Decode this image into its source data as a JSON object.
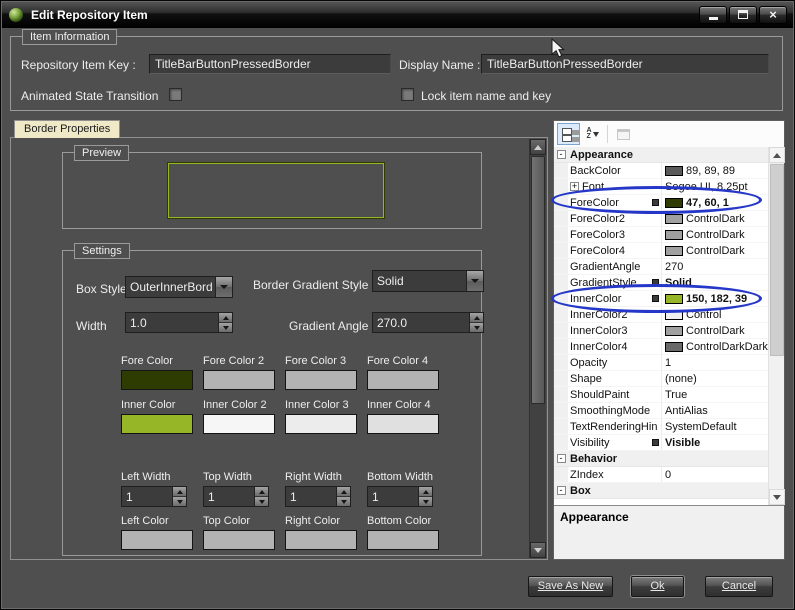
{
  "window": {
    "title": "Edit Repository Item"
  },
  "icons": {
    "close": "×",
    "category_collapse": "-",
    "node_expand": "+"
  },
  "item_information": {
    "group_label": "Item Information",
    "key_label": "Repository Item Key :",
    "key_value": "TitleBarButtonPressedBorder",
    "display_name_label": "Display Name :",
    "display_name_value": "TitleBarButtonPressedBorder",
    "animated_label": "Animated State Transition",
    "lock_label": "Lock item name and key"
  },
  "tabs": {
    "border_properties": "Border Properties"
  },
  "preview": {
    "group_label": "Preview",
    "outer_border": "#2f3c01",
    "inner_border": "#96b627"
  },
  "settings": {
    "group_label": "Settings",
    "box_style_label": "Box Style",
    "box_style_value": "OuterInnerBord",
    "gradient_style_label": "Border Gradient Style",
    "gradient_style_value": "Solid",
    "width_label": "Width",
    "width_value": "1.0",
    "gradient_angle_label": "Gradient Angle",
    "gradient_angle_value": "270.0",
    "fore_colors": [
      {
        "label": "Fore Color",
        "color": "#2f3c01"
      },
      {
        "label": "Fore Color 2",
        "color": "#b2b2b2"
      },
      {
        "label": "Fore Color 3",
        "color": "#b2b2b2"
      },
      {
        "label": "Fore Color 4",
        "color": "#b2b2b2"
      }
    ],
    "inner_colors": [
      {
        "label": "Inner Color",
        "color": "#96b627"
      },
      {
        "label": "Inner Color 2",
        "color": "#f6f6f6"
      },
      {
        "label": "Inner Color 3",
        "color": "#ececec"
      },
      {
        "label": "Inner Color 4",
        "color": "#e0e0e0"
      }
    ],
    "side_widths": [
      {
        "label": "Left Width",
        "value": "1"
      },
      {
        "label": "Top Width",
        "value": "1"
      },
      {
        "label": "Right Width",
        "value": "1"
      },
      {
        "label": "Bottom Width",
        "value": "1"
      }
    ],
    "side_colors": [
      {
        "label": "Left Color",
        "color": "#b2b2b2"
      },
      {
        "label": "Top Color",
        "color": "#b2b2b2"
      },
      {
        "label": "Right Color",
        "color": "#b2b2b2"
      },
      {
        "label": "Bottom Color",
        "color": "#b2b2b2"
      }
    ]
  },
  "property_grid": {
    "toolbar": {
      "letter_a": "A",
      "letter_z": "Z"
    },
    "rows": [
      {
        "type": "category",
        "name": "Appearance"
      },
      {
        "name": "BackColor",
        "value": "89, 89, 89",
        "swatch": "#595959"
      },
      {
        "name": "Font",
        "value": "Segoe UI, 8.25pt",
        "expander": "+"
      },
      {
        "name": "ForeColor",
        "value": "47, 60, 1",
        "swatch": "#2f3c01",
        "bold": true,
        "marker": true
      },
      {
        "name": "ForeColor2",
        "value": "ControlDark",
        "swatch": "#a0a0a0"
      },
      {
        "name": "ForeColor3",
        "value": "ControlDark",
        "swatch": "#a0a0a0"
      },
      {
        "name": "ForeColor4",
        "value": "ControlDark",
        "swatch": "#a0a0a0"
      },
      {
        "name": "GradientAngle",
        "value": "270"
      },
      {
        "name": "GradientStyle",
        "value": "Solid",
        "bold": true,
        "marker": true
      },
      {
        "name": "InnerColor",
        "value": "150, 182, 39",
        "swatch": "#96b627",
        "bold": true,
        "marker": true
      },
      {
        "name": "InnerColor2",
        "value": "Control",
        "swatch": "#f0f0f0"
      },
      {
        "name": "InnerColor3",
        "value": "ControlDark",
        "swatch": "#a0a0a0"
      },
      {
        "name": "InnerColor4",
        "value": "ControlDarkDark",
        "swatch": "#696969"
      },
      {
        "name": "Opacity",
        "value": "1"
      },
      {
        "name": "Shape",
        "value": "(none)"
      },
      {
        "name": "ShouldPaint",
        "value": "True"
      },
      {
        "name": "SmoothingMode",
        "value": "AntiAlias"
      },
      {
        "name": "TextRenderingHin",
        "value": "SystemDefault"
      },
      {
        "name": "Visibility",
        "value": "Visible",
        "bold": true,
        "marker": true
      },
      {
        "type": "category",
        "name": "Behavior"
      },
      {
        "name": "ZIndex",
        "value": "0"
      },
      {
        "type": "category",
        "name": "Box"
      }
    ],
    "help_title": "Appearance"
  },
  "footer": {
    "save_as_new": "Save As New",
    "ok": "Ok",
    "cancel": "Cancel"
  },
  "annotations": {
    "highlight_color": "#2437c8"
  }
}
